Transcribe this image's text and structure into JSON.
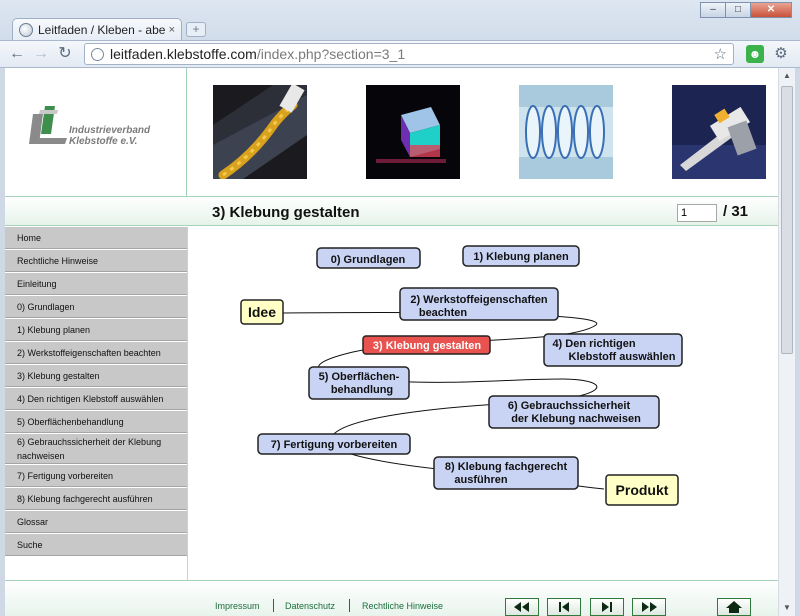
{
  "browser": {
    "tab_title": "Leitfaden / Kleben - aber",
    "tab_close": "×",
    "new_tab": "+",
    "url_host": "leitfaden.klebstoffe.com",
    "url_path": "/index.php?section=3_1"
  },
  "logo": {
    "line1": "Industrieverband",
    "line2": "Klebstoffe e.V."
  },
  "header": {
    "title": "3) Klebung gestalten",
    "page_value": "1",
    "page_total": "/ 31"
  },
  "sidebar": {
    "items": [
      {
        "label": "Home"
      },
      {
        "label": "Rechtliche Hinweise"
      },
      {
        "label": "Einleitung"
      },
      {
        "label": "0) Grundlagen"
      },
      {
        "label": "1) Klebung planen"
      },
      {
        "label": "2) Werkstoffeigenschaften beachten"
      },
      {
        "label": "3) Klebung gestalten"
      },
      {
        "label": "4) Den richtigen Klebstoff auswählen"
      },
      {
        "label": "5) Oberflächenbehandlung"
      },
      {
        "label": "6) Gebrauchssicherheit der Klebung",
        "label2": "nachweisen"
      },
      {
        "label": "7) Fertigung vorbereiten"
      },
      {
        "label": "8) Klebung fachgerecht ausführen"
      },
      {
        "label": "Glossar"
      },
      {
        "label": "Suche"
      }
    ]
  },
  "diagram": {
    "start": "Idee",
    "end": "Produkt",
    "steps": [
      {
        "l1": "0) Grundlagen",
        "l2": ""
      },
      {
        "l1": "1) Klebung planen",
        "l2": ""
      },
      {
        "l1": "2) Werkstoffeigenschaften",
        "l2": "beachten"
      },
      {
        "l1": "3) Klebung gestalten",
        "l2": ""
      },
      {
        "l1": "4) Den richtigen",
        "l2": "Klebstoff auswählen"
      },
      {
        "l1": "5) Oberflächen-",
        "l2": "behandlung"
      },
      {
        "l1": "6) Gebrauchssicherheit",
        "l2": "der Klebung nachweisen"
      },
      {
        "l1": "7) Fertigung vorbereiten",
        "l2": ""
      },
      {
        "l1": "8) Klebung fachgerecht",
        "l2": "ausführen"
      }
    ],
    "colors": {
      "step": "#c9d4f5",
      "active": "#e8534f",
      "terminal": "#ffffc6"
    }
  },
  "footer": {
    "links": [
      "Impressum",
      "Datenschutz",
      "Rechtliche Hinweise"
    ],
    "buttons": [
      "first-page",
      "previous-page",
      "next-page",
      "last-page",
      "home"
    ]
  }
}
